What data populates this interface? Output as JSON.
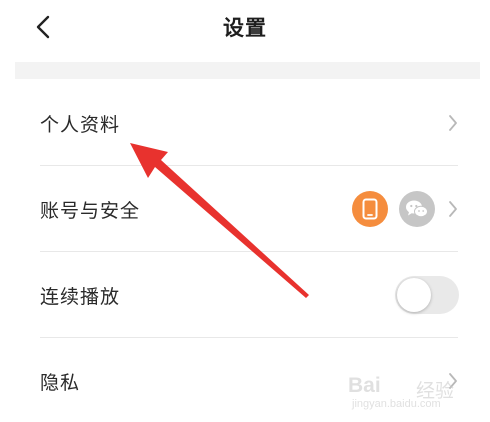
{
  "header": {
    "title": "设置"
  },
  "settings": {
    "items": [
      {
        "label": "个人资料"
      },
      {
        "label": "账号与安全"
      },
      {
        "label": "连续播放",
        "toggle_on": false
      },
      {
        "label": "隐私"
      }
    ]
  },
  "icons": {
    "back": "chevron-left-icon",
    "chevron": "chevron-right-icon",
    "phone": "phone-icon",
    "wechat": "wechat-icon"
  },
  "colors": {
    "phone_badge": "#f58d3e",
    "wechat_badge": "#c6c6c6",
    "annotation_arrow": "#e8322e",
    "toggle_off": "#e9e9e9"
  },
  "watermark": {
    "brand": "Bai",
    "cn": "经验",
    "url": "jingyan.baidu.com"
  }
}
